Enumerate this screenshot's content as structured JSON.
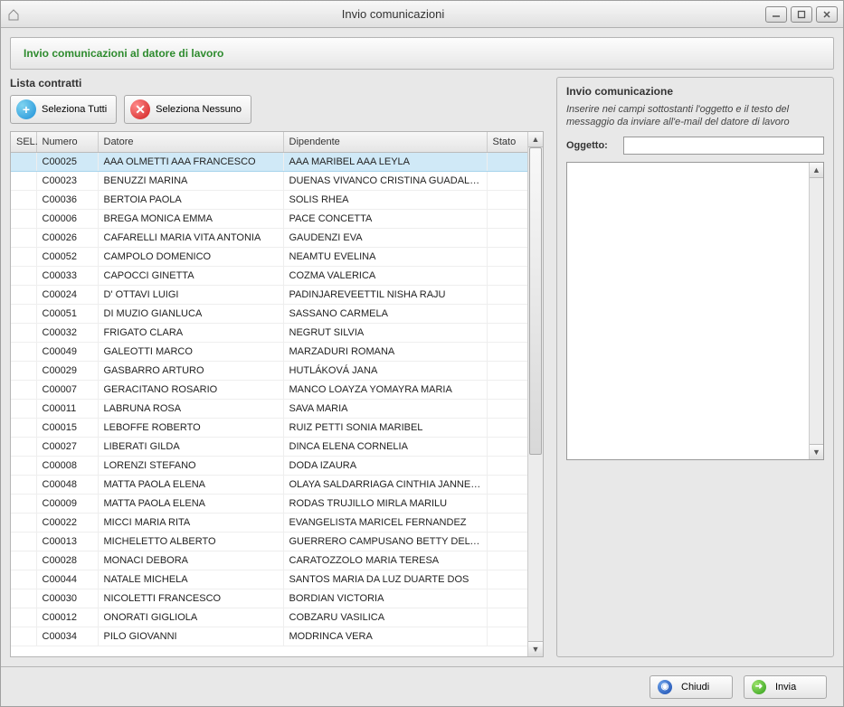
{
  "window": {
    "title": "Invio comunicazioni"
  },
  "header": {
    "subtitle": "Invio comunicazioni al datore di lavoro"
  },
  "left": {
    "title": "Lista contratti",
    "select_all": "Seleziona Tutti",
    "select_none": "Seleziona Nessuno",
    "columns": {
      "sel": "SEL.",
      "numero": "Numero",
      "datore": "Datore",
      "dipendente": "Dipendente",
      "stato": "Stato"
    },
    "rows": [
      {
        "num": "C00025",
        "dat": "AAA OLMETTI AAA FRANCESCO",
        "dip": "AAA MARIBEL AAA LEYLA",
        "stato": "",
        "selected": true
      },
      {
        "num": "C00023",
        "dat": "BENUZZI MARINA",
        "dip": "DUENAS VIVANCO CRISTINA GUADALUPE",
        "stato": ""
      },
      {
        "num": "C00036",
        "dat": "BERTOIA PAOLA",
        "dip": "SOLIS RHEA",
        "stato": ""
      },
      {
        "num": "C00006",
        "dat": "BREGA MONICA EMMA",
        "dip": "PACE CONCETTA",
        "stato": ""
      },
      {
        "num": "C00026",
        "dat": "CAFARELLI MARIA VITA ANTONIA",
        "dip": "GAUDENZI EVA",
        "stato": ""
      },
      {
        "num": "C00052",
        "dat": "CAMPOLO DOMENICO",
        "dip": "NEAMTU EVELINA",
        "stato": ""
      },
      {
        "num": "C00033",
        "dat": "CAPOCCI GINETTA",
        "dip": "COZMA VALERICA",
        "stato": ""
      },
      {
        "num": "C00024",
        "dat": "D' OTTAVI LUIGI",
        "dip": "PADINJAREVEETTIL NISHA RAJU",
        "stato": ""
      },
      {
        "num": "C00051",
        "dat": "DI MUZIO GIANLUCA",
        "dip": "SASSANO CARMELA",
        "stato": ""
      },
      {
        "num": "C00032",
        "dat": "FRIGATO  CLARA",
        "dip": "NEGRUT SILVIA",
        "stato": ""
      },
      {
        "num": "C00049",
        "dat": "GALEOTTI MARCO",
        "dip": "MARZADURI ROMANA",
        "stato": ""
      },
      {
        "num": "C00029",
        "dat": "GASBARRO ARTURO",
        "dip": "HUTLÁKOVÁ JANA",
        "stato": ""
      },
      {
        "num": "C00007",
        "dat": "GERACITANO ROSARIO",
        "dip": "MANCO  LOAYZA YOMAYRA MARIA",
        "stato": ""
      },
      {
        "num": "C00011",
        "dat": "LABRUNA ROSA",
        "dip": "SAVA MARIA",
        "stato": ""
      },
      {
        "num": "C00015",
        "dat": "LEBOFFE ROBERTO",
        "dip": "RUIZ PETTI SONIA MARIBEL",
        "stato": ""
      },
      {
        "num": "C00027",
        "dat": "LIBERATI GILDA",
        "dip": "DINCA ELENA CORNELIA",
        "stato": ""
      },
      {
        "num": "C00008",
        "dat": "LORENZI STEFANO",
        "dip": "DODA IZAURA",
        "stato": ""
      },
      {
        "num": "C00048",
        "dat": "MATTA PAOLA ELENA",
        "dip": "OLAYA SALDARRIAGA CINTHIA JANNETT",
        "stato": ""
      },
      {
        "num": "C00009",
        "dat": "MATTA PAOLA ELENA",
        "dip": "RODAS TRUJILLO MIRLA MARILU",
        "stato": ""
      },
      {
        "num": "C00022",
        "dat": "MICCI MARIA RITA",
        "dip": "EVANGELISTA MARICEL FERNANDEZ",
        "stato": ""
      },
      {
        "num": "C00013",
        "dat": "MICHELETTO ALBERTO",
        "dip": "GUERRERO CAMPUSANO BETTY DEL PILA",
        "stato": ""
      },
      {
        "num": "C00028",
        "dat": "MONACI DEBORA",
        "dip": "CARATOZZOLO MARIA TERESA",
        "stato": ""
      },
      {
        "num": "C00044",
        "dat": "NATALE MICHELA",
        "dip": "SANTOS MARIA DA LUZ DUARTE DOS",
        "stato": ""
      },
      {
        "num": "C00030",
        "dat": "NICOLETTI FRANCESCO",
        "dip": "BORDIAN VICTORIA",
        "stato": ""
      },
      {
        "num": "C00012",
        "dat": "ONORATI GIGLIOLA",
        "dip": "COBZARU VASILICA",
        "stato": ""
      },
      {
        "num": "C00034",
        "dat": "PILO GIOVANNI",
        "dip": "MODRINCA VERA",
        "stato": ""
      }
    ]
  },
  "right": {
    "title": "Invio comunicazione",
    "instructions": "Inserire nei campi sottostanti l'oggetto e il testo del messaggio da inviare all'e-mail del datore di lavoro",
    "subject_label": "Oggetto:",
    "subject_value": "",
    "body_value": ""
  },
  "footer": {
    "close": "Chiudi",
    "send": "Invia"
  }
}
